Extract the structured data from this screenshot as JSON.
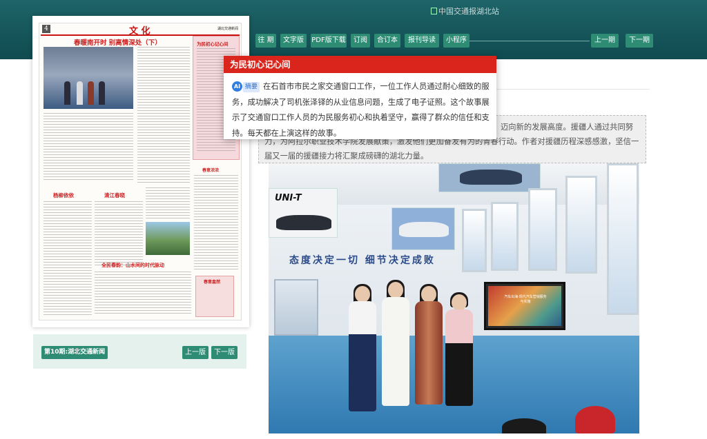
{
  "site": {
    "logo_alt": "中国交通报湖北站"
  },
  "nav": {
    "items": [
      "往 期",
      "文字版",
      "PDF版下载",
      "订阅",
      "合订本",
      "报刊导读",
      "小程序"
    ],
    "prev_issue": "上一期",
    "next_issue": "下一期"
  },
  "thumbnail": {
    "page_number": "4",
    "section_title": "文 化",
    "paper_name": "湖北交通新闻",
    "headline_main": "春暖南开时 别离情深处（下）",
    "headline_side": "为民初心记心间",
    "heading_a": "杨柳依依",
    "heading_b": "清江春晓",
    "heading_c": "全民春韵：山水间的时代脉动",
    "heading_d": "春意盎然",
    "heading_e": "春意浓浓"
  },
  "edition": {
    "label": "第10期:湖北交通新闻",
    "prev_page": "上一版",
    "next_page": "下一版"
  },
  "popup": {
    "title": "为民初心记心间",
    "ai_badge": "AI",
    "tag": "摘要",
    "text": "在石首市市民之家交通窗口工作，一位工作人员通过耐心细致的服务，成功解决了司机张泽铎的从业信息问题，生成了电子证照。这个故事展示了交通窗口工作人员的为民服务初心和执着坚守，赢得了群众的信任和支持。每天都在上演这样的故事。"
  },
  "summary": {
    "line1": "迈向新的发展高度。援疆人通过共同努",
    "line2": "力，为阿拉尔职业技术学院发展献策，激发他们更加奋发有为的青春行动。作者对援疆历程深感感激，坚信一",
    "line3": "届又一届的援疆接力将汇聚成磅礴的湖北力量。"
  },
  "photo": {
    "slogan": "态度决定一切  细节决定成败",
    "banner_brand": "UNI-T",
    "tv_text": "汽车出海·现代汽车营销服务与实施"
  },
  "colors": {
    "teal_header": "#1e6468",
    "button_green": "#2e8b74",
    "popup_red": "#d9251c"
  }
}
